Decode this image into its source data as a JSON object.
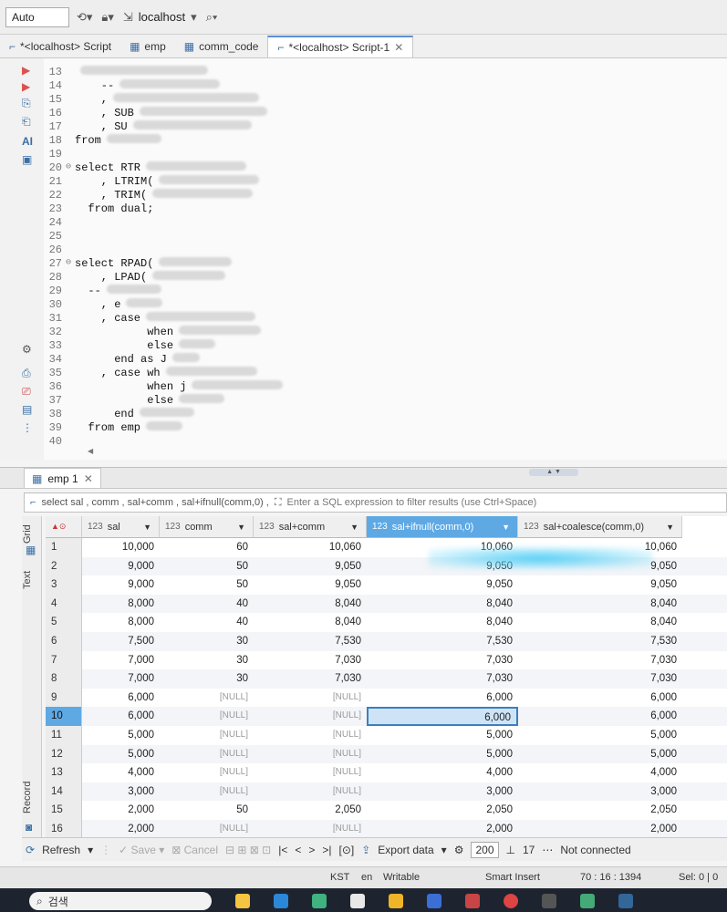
{
  "toolbar": {
    "transaction_mode": "Auto",
    "connection": "localhost"
  },
  "editor_tabs": [
    {
      "label": "*<localhost> Script",
      "active": false
    },
    {
      "label": "emp",
      "active": false
    },
    {
      "label": "comm_code",
      "active": false
    },
    {
      "label": "*<localhost> Script-1",
      "active": true
    }
  ],
  "editor": {
    "lines": [
      {
        "n": "13",
        "code": ""
      },
      {
        "n": "14",
        "code": "    --"
      },
      {
        "n": "15",
        "code": "    ,"
      },
      {
        "n": "16",
        "code": "    , SUB"
      },
      {
        "n": "17",
        "code": "    , SU"
      },
      {
        "n": "18",
        "code": "from"
      },
      {
        "n": "19",
        "code": ""
      },
      {
        "n": "20",
        "code": "select RTR"
      },
      {
        "n": "21",
        "code": "    , LTRIM("
      },
      {
        "n": "22",
        "code": "    , TRIM("
      },
      {
        "n": "23",
        "code": "  from dual;"
      },
      {
        "n": "24",
        "code": ""
      },
      {
        "n": "25",
        "code": ""
      },
      {
        "n": "26",
        "code": ""
      },
      {
        "n": "27",
        "code": "select RPAD("
      },
      {
        "n": "28",
        "code": "    , LPAD("
      },
      {
        "n": "29",
        "code": "  --"
      },
      {
        "n": "30",
        "code": "    , e"
      },
      {
        "n": "31",
        "code": "    , case"
      },
      {
        "n": "32",
        "code": "           when"
      },
      {
        "n": "33",
        "code": "           else"
      },
      {
        "n": "34",
        "code": "      end as J"
      },
      {
        "n": "35",
        "code": "    , case wh"
      },
      {
        "n": "36",
        "code": "           when j"
      },
      {
        "n": "37",
        "code": "           else"
      },
      {
        "n": "38",
        "code": "      end"
      },
      {
        "n": "39",
        "code": "  from emp"
      },
      {
        "n": "40",
        "code": ""
      }
    ]
  },
  "results": {
    "tab_label": "emp 1",
    "query": "select sal , comm , sal+comm , sal+ifnull(comm,0) ,",
    "filter_placeholder": "Enter a SQL expression to filter results (use Ctrl+Space)",
    "side_tabs": [
      "Grid",
      "Text",
      "Record"
    ],
    "columns": [
      {
        "type": "123",
        "name": "sal"
      },
      {
        "type": "123",
        "name": "comm"
      },
      {
        "type": "123",
        "name": "sal+comm"
      },
      {
        "type": "123",
        "name": "sal+ifnull(comm,0)"
      },
      {
        "type": "123",
        "name": "sal+coalesce(comm,0)"
      }
    ],
    "rows": [
      {
        "n": "1",
        "c": [
          "10,000",
          "60",
          "10,060",
          "10,060",
          "10,060"
        ]
      },
      {
        "n": "2",
        "c": [
          "9,000",
          "50",
          "9,050",
          "9,050",
          "9,050"
        ]
      },
      {
        "n": "3",
        "c": [
          "9,000",
          "50",
          "9,050",
          "9,050",
          "9,050"
        ]
      },
      {
        "n": "4",
        "c": [
          "8,000",
          "40",
          "8,040",
          "8,040",
          "8,040"
        ]
      },
      {
        "n": "5",
        "c": [
          "8,000",
          "40",
          "8,040",
          "8,040",
          "8,040"
        ]
      },
      {
        "n": "6",
        "c": [
          "7,500",
          "30",
          "7,530",
          "7,530",
          "7,530"
        ]
      },
      {
        "n": "7",
        "c": [
          "7,000",
          "30",
          "7,030",
          "7,030",
          "7,030"
        ]
      },
      {
        "n": "8",
        "c": [
          "7,000",
          "30",
          "7,030",
          "7,030",
          "7,030"
        ]
      },
      {
        "n": "9",
        "c": [
          "6,000",
          "[NULL]",
          "[NULL]",
          "6,000",
          "6,000"
        ]
      },
      {
        "n": "10",
        "c": [
          "6,000",
          "[NULL]",
          "[NULL]",
          "6,000",
          "6,000"
        ]
      },
      {
        "n": "11",
        "c": [
          "5,000",
          "[NULL]",
          "[NULL]",
          "5,000",
          "5,000"
        ]
      },
      {
        "n": "12",
        "c": [
          "5,000",
          "[NULL]",
          "[NULL]",
          "5,000",
          "5,000"
        ]
      },
      {
        "n": "13",
        "c": [
          "4,000",
          "[NULL]",
          "[NULL]",
          "4,000",
          "4,000"
        ]
      },
      {
        "n": "14",
        "c": [
          "3,000",
          "[NULL]",
          "[NULL]",
          "3,000",
          "3,000"
        ]
      },
      {
        "n": "15",
        "c": [
          "2,000",
          "50",
          "2,050",
          "2,050",
          "2,050"
        ]
      },
      {
        "n": "16",
        "c": [
          "2,000",
          "[NULL]",
          "[NULL]",
          "2,000",
          "2,000"
        ]
      }
    ]
  },
  "result_toolbar": {
    "refresh": "Refresh",
    "save": "Save",
    "cancel": "Cancel",
    "export": "Export data",
    "fetch_size": "200",
    "row_count": "17",
    "status": "Not connected"
  },
  "statusbar": {
    "timezone": "KST",
    "locale": "en",
    "mode": "Writable",
    "insert": "Smart Insert",
    "position": "70 : 16 : 1394",
    "selection": "Sel: 0 | 0"
  },
  "taskbar": {
    "search": "검색"
  }
}
